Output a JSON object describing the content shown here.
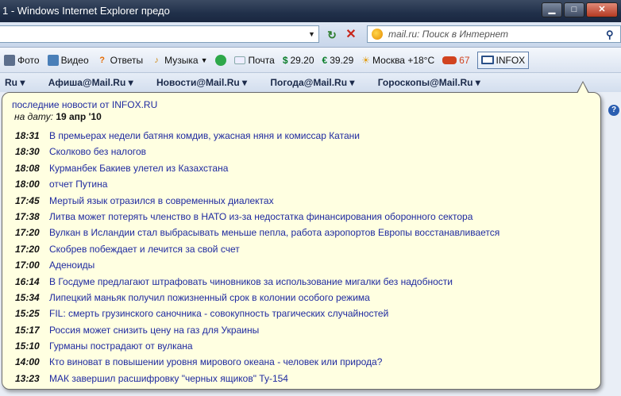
{
  "window": {
    "title": "1 - Windows Internet Explorer предо",
    "minimize": "▁",
    "maximize": "□",
    "close": "✕"
  },
  "search": {
    "placeholder": "mail.ru: Поиск в Интернет"
  },
  "toolbar": {
    "photo": "Фото",
    "video": "Видео",
    "answers": "Ответы",
    "music": "Музыка",
    "mail": "Почта",
    "usd_symbol": "$",
    "usd_rate": "29.20",
    "eur_symbol": "€",
    "eur_rate": "39.29",
    "weather": "Москва +18°С",
    "traffic": "67",
    "infox": "INFOX"
  },
  "bookmarks": [
    "Ru ▾",
    "Афиша@Mail.Ru ▾",
    "Новости@Mail.Ru ▾",
    "Погода@Mail.Ru ▾",
    "Гороскопы@Mail.Ru ▾"
  ],
  "popup": {
    "header": "последние новости от INFOX.RU",
    "date_label": "на дату:",
    "date_value": "19 апр '10",
    "news": [
      {
        "time": "18:31",
        "title": "В премьерах недели батяня комдив, ужасная няня и комиссар Катани"
      },
      {
        "time": "18:30",
        "title": "Сколково без налогов"
      },
      {
        "time": "18:08",
        "title": "Курманбек Бакиев улетел из Казахстана"
      },
      {
        "time": "18:00",
        "title": "отчет Путина"
      },
      {
        "time": "17:45",
        "title": "Мертый язык отразился в современных диалектах"
      },
      {
        "time": "17:38",
        "title": "Литва может потерять членство в НАТО из-за недостатка финансирования оборонного сектора"
      },
      {
        "time": "17:20",
        "title": "Вулкан в Исландии стал выбрасывать меньше пепла, работа аэропортов Европы восстанавливается"
      },
      {
        "time": "17:20",
        "title": "Скобрев побеждает и лечится за свой счет"
      },
      {
        "time": "17:00",
        "title": "Аденоиды"
      },
      {
        "time": "16:14",
        "title": "В Госдуме предлагают штрафовать чиновников за использование мигалки без надобности"
      },
      {
        "time": "15:34",
        "title": "Липецкий маньяк получил пожизненный срок в колонии особого режима"
      },
      {
        "time": "15:25",
        "title": "FIL: смерть грузинского саночника - совокупность трагических случайностей"
      },
      {
        "time": "15:17",
        "title": "Россия может снизить цену на газ для Украины"
      },
      {
        "time": "15:10",
        "title": "Гурманы пострадают от вулкана"
      },
      {
        "time": "14:00",
        "title": "Кто виноват в повышении уровня мирового океана - человек или природа?"
      },
      {
        "time": "13:23",
        "title": "МАК завершил расшифровку \"черных ящиков\" Ту-154"
      }
    ]
  }
}
